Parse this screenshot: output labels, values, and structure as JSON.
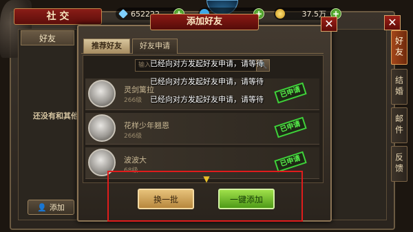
{
  "window": {
    "title": "社 交"
  },
  "resources": [
    {
      "name": "diamond",
      "value": "652222",
      "color": "#7fd0ff"
    },
    {
      "name": "gem",
      "value": "",
      "color": "#3fa8e8"
    },
    {
      "name": "gold",
      "value": "37.5万",
      "color": "#f0c030"
    }
  ],
  "left_panel": {
    "tab_label": "好友",
    "empty_message": "还没有和其他",
    "add_button_label": "添加"
  },
  "side_tabs": [
    "好友",
    "结婚",
    "邮件",
    "反馈"
  ],
  "dialog": {
    "title": "添加好友",
    "tabs": [
      "推荐好友",
      "好友申请"
    ],
    "search_placeholder": "输入",
    "toasts": [
      "已经向对方发起好友申请，请等待",
      "已经向对方发起好友申请，请等待",
      "已经向对方发起好友申请，请等待"
    ],
    "players": [
      {
        "name": "灵剑篱拉",
        "level": "266级",
        "status": "已申请"
      },
      {
        "name": "花样少年翘恩",
        "level": "266级",
        "status": "已申请"
      },
      {
        "name": "波波大",
        "level": "68级",
        "status": "已申请"
      }
    ],
    "buttons": {
      "refresh": "换一批",
      "add_all": "一键添加"
    }
  },
  "colors": {
    "accent_red": "#8c1a14",
    "status_green": "#3fd23a",
    "gold": "#e6c17a"
  }
}
